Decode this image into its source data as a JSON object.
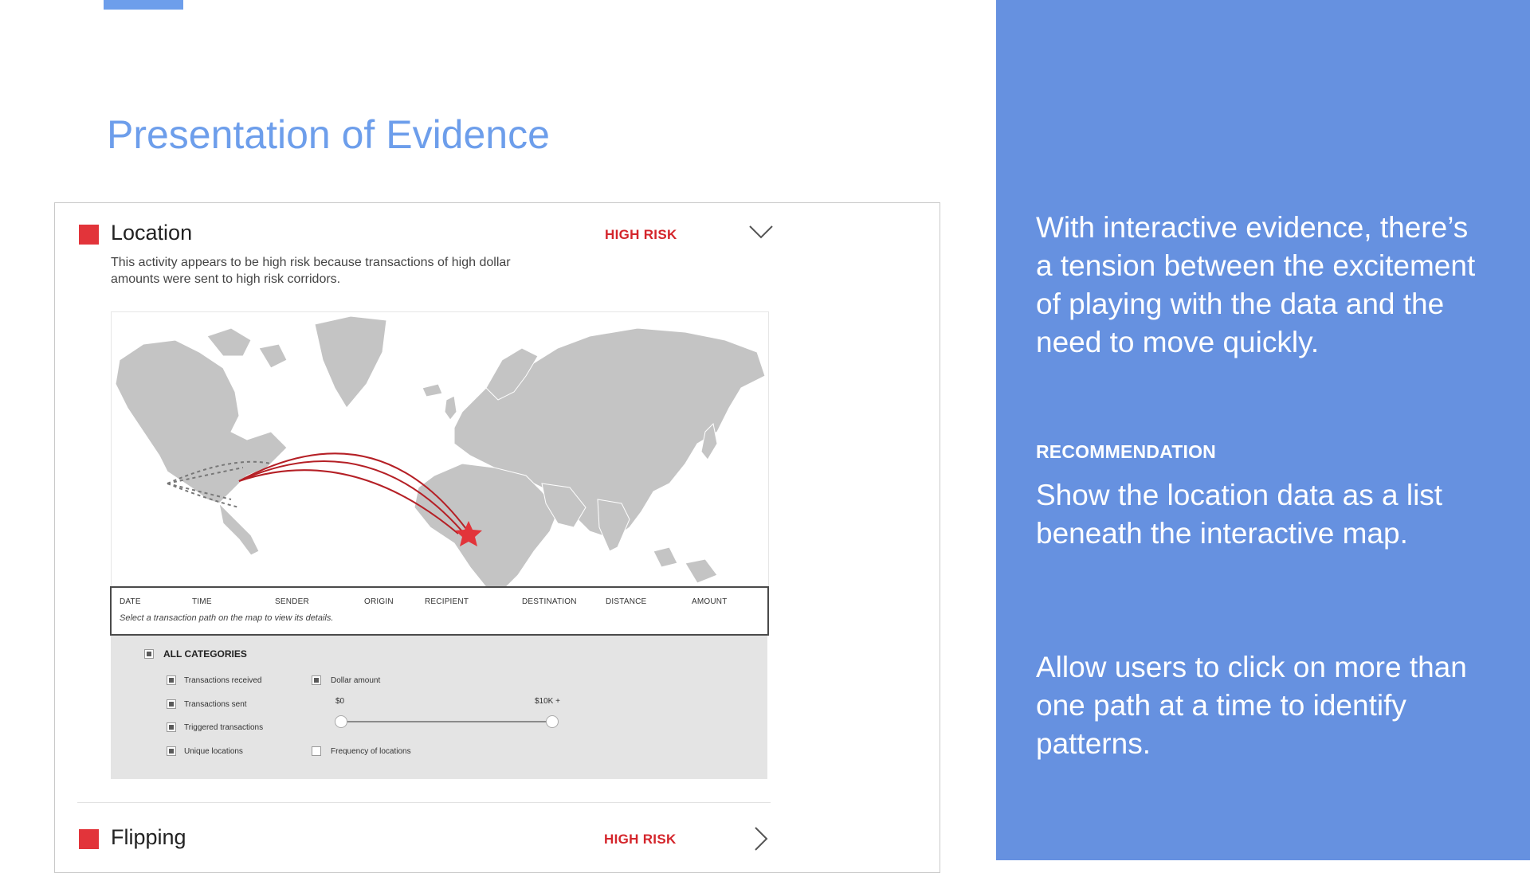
{
  "slide": {
    "title": "Presentation of Evidence"
  },
  "right_panel": {
    "intro": "With interactive evidence, there’s a tension between the excitement of playing with the data and the need to move quickly.",
    "heading": "RECOMMENDATION",
    "rec1": "Show the location data as a list beneath the interactive map.",
    "rec2": "Allow users to click on more than one path at a time to identify patterns."
  },
  "location": {
    "title": "Location",
    "risk": "HIGH RISK",
    "description": "This activity appears to be high risk because transactions of high dollar amounts were sent to high risk corridors.",
    "table": {
      "columns": [
        "DATE",
        "TIME",
        "SENDER",
        "ORIGIN",
        "RECIPIENT",
        "DESTINATION",
        "DISTANCE",
        "AMOUNT"
      ],
      "hint": "Select a transaction path on the map to view its details."
    },
    "filters": {
      "all": "ALL CATEGORIES",
      "items": [
        "Transactions received",
        "Transactions sent",
        "Triggered transactions",
        "Unique locations"
      ],
      "dollar_amount": "Dollar amount",
      "slider_min": "$0",
      "slider_max": "$10K +",
      "frequency": "Frequency of locations"
    }
  },
  "flipping": {
    "title": "Flipping",
    "risk": "HIGH RISK"
  },
  "colors": {
    "accent_blue": "#6d9eeb",
    "panel_blue": "#6691e0",
    "risk_red": "#e2343a"
  }
}
